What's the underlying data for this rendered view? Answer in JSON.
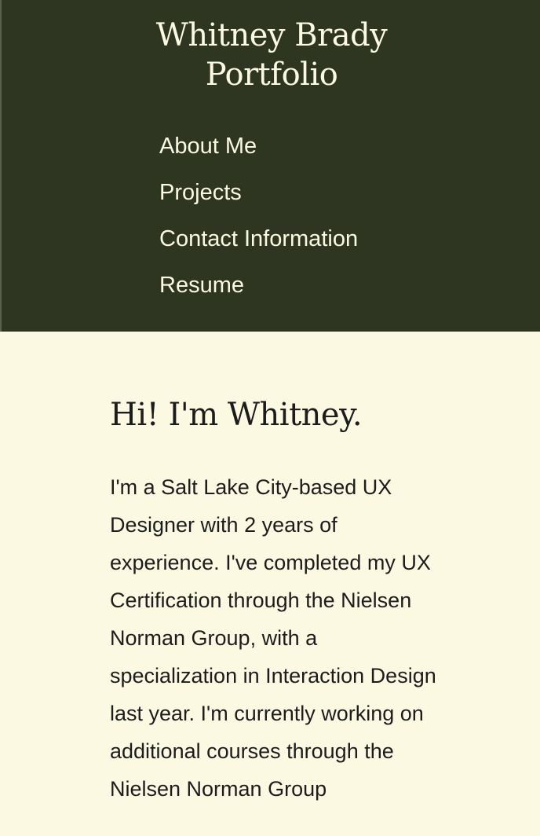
{
  "header": {
    "title_line1": "Whitney Brady",
    "title_line2": "Portfolio"
  },
  "nav": {
    "items": [
      {
        "label": "About Me"
      },
      {
        "label": "Projects"
      },
      {
        "label": "Contact Information"
      },
      {
        "label": "Resume"
      }
    ]
  },
  "main": {
    "greeting": "Hi! I'm Whitney.",
    "bio": "I'm a Salt Lake City-based UX Designer with 2 years of experience. I've completed my UX Certification through the Nielsen Norman Group, with a specialization in Interaction Design last year. I'm currently working on additional courses through the Nielsen Norman Group"
  },
  "colors": {
    "header_bg": "#2e3520",
    "page_bg": "#fcf9e3",
    "header_text": "#fcf9e3",
    "body_text": "#1c1c1c"
  }
}
